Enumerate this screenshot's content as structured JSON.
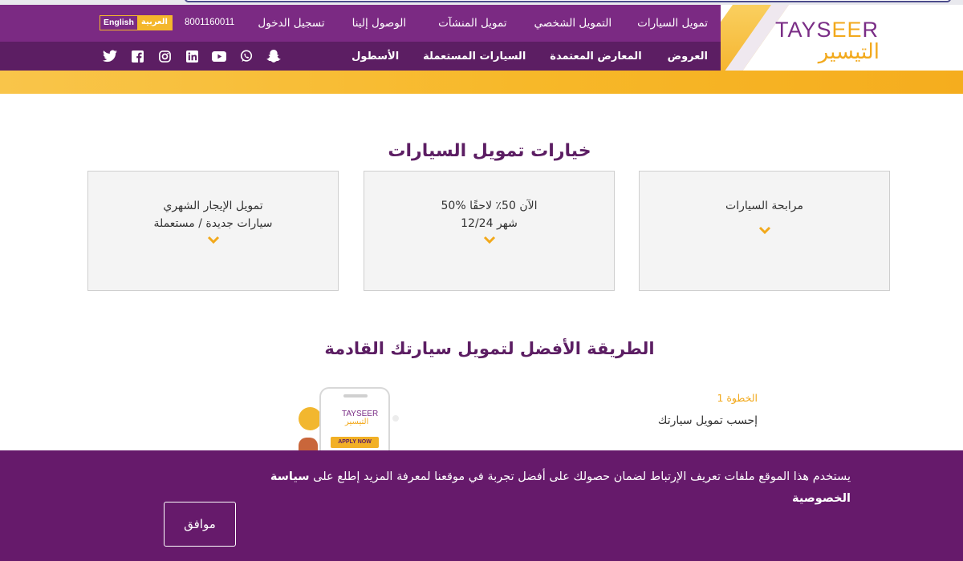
{
  "brand": {
    "logo_en_a": "TAYS",
    "logo_en_b": "EE",
    "logo_en_c": "R",
    "logo_ar": "التيسير",
    "colors": {
      "purple": "#7b2a83",
      "dark_purple": "#5c1e63",
      "yellow": "#f4b72c"
    }
  },
  "top_nav": {
    "items": [
      "تمويل السيارات",
      "التمويل الشخصي",
      "تمويل المنشآت",
      "الوصول إلينا",
      "تسجيل الدخول"
    ],
    "phone": "8001160011",
    "lang_en": "English",
    "lang_ar": "العربية"
  },
  "bottom_nav": {
    "items": [
      "العروض",
      "المعارض المعتمدة",
      "السيارات المستعملة",
      "الأسطول"
    ]
  },
  "socials": [
    "twitter-icon",
    "facebook-icon",
    "instagram-icon",
    "linkedin-icon",
    "youtube-icon",
    "whatsapp-icon",
    "snapchat-icon"
  ],
  "financing_options": {
    "title": "خيارات تمويل السيارات",
    "cards": [
      {
        "line1": "مرابحة السيارات",
        "line2": ""
      },
      {
        "line1": "50% الآن 50٪ لاحقًا",
        "line2": "12/24 شهر"
      },
      {
        "line1": "تمويل الإيجار الشهري",
        "line2": "سيارات جديدة / مستعملة"
      }
    ]
  },
  "best_way": {
    "title": "الطريقة الأفضل لتمويل سيارتك القادمة",
    "step_label": "الخطوة 1",
    "step_text": "إحسب تمويل سيارتك",
    "phone_logo_en": "TAYSEER",
    "phone_logo_ar": "التيسير",
    "apply_label": "APPLY NOW"
  },
  "cookie_banner": {
    "text": "يستخدم هذا الموقع ملفات تعريف الإرتباط لضمان حصولك على أفضل تجربة في موقعنا لمعرفة المزيد إطلع على",
    "policy_link": "سياسة الخصوصية",
    "agree_label": "موافق"
  }
}
